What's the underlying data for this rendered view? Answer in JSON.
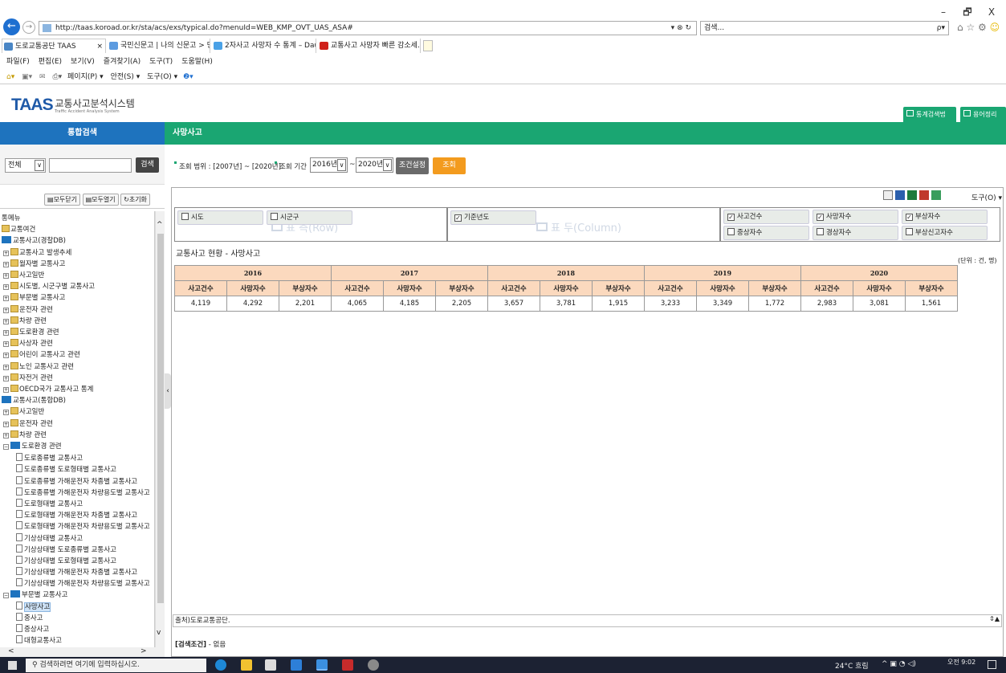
{
  "browser": {
    "url": "http://taas.koroad.or.kr/sta/acs/exs/typical.do?menuId=WEB_KMP_OVT_UAS_ASA#",
    "url_host_bold": "koroad.or.kr",
    "search_placeholder": "검색...",
    "search_icon_label": "ρ▾",
    "tabs": [
      {
        "label": "도로교통공단 TAAS",
        "close": "×"
      },
      {
        "label": "국민신문고 | 나의 신문고 > 민..."
      },
      {
        "label": "2자사고 사망자 수 통계 – Dau..."
      },
      {
        "label": "교통사고 사망자 빠른 감소세..."
      }
    ],
    "menu": [
      "파일(F)",
      "편집(E)",
      "보기(V)",
      "즐겨찾기(A)",
      "도구(T)",
      "도움말(H)"
    ],
    "toolbar": [
      "페이지(P) ▾",
      "안전(S) ▾",
      "도구(O) ▾"
    ],
    "window_controls": [
      "–",
      "🗗",
      "X"
    ]
  },
  "site": {
    "logo": "TAAS",
    "title": "교통사고분석시스템",
    "subtitle": "Traffic Accident Analysis System",
    "top_buttons": [
      "통계검색법",
      "용어정리"
    ]
  },
  "left": {
    "header": "통합검색",
    "select_value": "전체",
    "search_button": "검색",
    "tree_buttons": [
      "모두닫기",
      "모두열기",
      "초기화"
    ],
    "tree": [
      {
        "text": "통메뉴",
        "kind": "plain",
        "indent": 0
      },
      {
        "text": "교통여건",
        "kind": "fold",
        "indent": 0
      },
      {
        "text": "교통사고(경찰DB)",
        "kind": "open",
        "indent": 0
      },
      {
        "text": "교통사고 발생추세",
        "kind": "pfold",
        "indent": 1
      },
      {
        "text": "월자별 교통사고",
        "kind": "pfold",
        "indent": 1
      },
      {
        "text": "사고일반",
        "kind": "pfold",
        "indent": 1
      },
      {
        "text": "시도별, 시군구별 교통사고",
        "kind": "pfold",
        "indent": 1
      },
      {
        "text": "부문별 교통사고",
        "kind": "pfold",
        "indent": 1
      },
      {
        "text": "운전자 관련",
        "kind": "pfold",
        "indent": 1
      },
      {
        "text": "차량 관련",
        "kind": "pfold",
        "indent": 1
      },
      {
        "text": "도로환경 관련",
        "kind": "pfold",
        "indent": 1
      },
      {
        "text": "사상자 관련",
        "kind": "pfold",
        "indent": 1
      },
      {
        "text": "어린이 교통사고 관련",
        "kind": "pfold",
        "indent": 1
      },
      {
        "text": "노인 교통사고 관련",
        "kind": "pfold",
        "indent": 1
      },
      {
        "text": "자전거 관련",
        "kind": "pfold",
        "indent": 1
      },
      {
        "text": "OECD국가 교통사고 통계",
        "kind": "pfold",
        "indent": 1
      },
      {
        "text": "교통사고(통합DB)",
        "kind": "open",
        "indent": 0
      },
      {
        "text": "사고일반",
        "kind": "pfold",
        "indent": 1
      },
      {
        "text": "운전자 관련",
        "kind": "pfold",
        "indent": 1
      },
      {
        "text": "차량 관련",
        "kind": "pfold",
        "indent": 1
      },
      {
        "text": "도로환경 관련",
        "kind": "popen",
        "indent": 1
      },
      {
        "text": "도로종류별 교통사고",
        "kind": "doc",
        "indent": 2
      },
      {
        "text": "도로종류별 도로형태별 교통사고",
        "kind": "doc",
        "indent": 2
      },
      {
        "text": "도로종류별 가해운전자 차종별 교통사고",
        "kind": "doc",
        "indent": 2
      },
      {
        "text": "도로종류별 가해운전자 차량용도별 교통사고",
        "kind": "doc",
        "indent": 2
      },
      {
        "text": "도로형태별 교통사고",
        "kind": "doc",
        "indent": 2
      },
      {
        "text": "도로형태별 가해운전자 차종별 교통사고",
        "kind": "doc",
        "indent": 2
      },
      {
        "text": "도로형태별 가해운전자 차량용도별 교통사고",
        "kind": "doc",
        "indent": 2
      },
      {
        "text": "기상상태별 교통사고",
        "kind": "doc",
        "indent": 2
      },
      {
        "text": "기상상태별 도로종류별 교통사고",
        "kind": "doc",
        "indent": 2
      },
      {
        "text": "기상상태별 도로형태별 교통사고",
        "kind": "doc",
        "indent": 2
      },
      {
        "text": "기상상태별 가해운전자 차종별 교통사고",
        "kind": "doc",
        "indent": 2
      },
      {
        "text": "기상상태별 가해운전자 차량용도별 교통사고",
        "kind": "doc",
        "indent": 2
      },
      {
        "text": "부문별 교통사고",
        "kind": "popen",
        "indent": 1
      },
      {
        "text": "사망사고",
        "kind": "docsel",
        "indent": 2
      },
      {
        "text": "중사고",
        "kind": "doc",
        "indent": 2
      },
      {
        "text": "중상사고",
        "kind": "doc",
        "indent": 2
      },
      {
        "text": "대형교통사고",
        "kind": "doc",
        "indent": 2
      }
    ]
  },
  "main": {
    "header": "사망사고",
    "range_label": "조회 범위 : [2007년] ~ [2020년]",
    "period_label": "조회 기간",
    "from_year": "2016년",
    "tilde": "~",
    "to_year": "2020년",
    "condition_button": "조건설정",
    "query_button": "조회",
    "tools_label": "도구(O) ▾",
    "row_dims": [
      {
        "label": "시도",
        "checked": false
      },
      {
        "label": "시군구",
        "checked": false
      }
    ],
    "row_watermark": "표 측(Row)",
    "col_dims": [
      {
        "label": "기준년도",
        "checked": true
      }
    ],
    "col_watermark": "표 두(Column)",
    "measures": [
      {
        "label": "사고건수",
        "checked": true
      },
      {
        "label": "사망자수",
        "checked": true
      },
      {
        "label": "부상자수",
        "checked": true
      },
      {
        "label": "중상자수",
        "checked": false
      },
      {
        "label": "경상자수",
        "checked": false
      },
      {
        "label": "부상신고자수",
        "checked": false
      }
    ],
    "table_title": "교통사고 현황 - 사망사고",
    "unit": "(단위 : 건, 명)",
    "years": [
      "2016",
      "2017",
      "2018",
      "2019",
      "2020"
    ],
    "col_headers": [
      "사고건수",
      "사망자수",
      "부상자수"
    ],
    "rows": [
      [
        "4,119",
        "4,292",
        "2,201",
        "4,065",
        "4,185",
        "2,205",
        "3,657",
        "3,781",
        "1,915",
        "3,233",
        "3,349",
        "1,772",
        "2,983",
        "3,081",
        "1,561"
      ]
    ],
    "footnote": "출처)도로교통공단.",
    "search_cond_label": "[검색조건]",
    "search_cond_value": "- 없음"
  },
  "taskbar": {
    "search_placeholder": "검색하려면 여기에 입력하십시오.",
    "weather": "24°C 흐림",
    "time": "오전 9:02"
  },
  "colors": {
    "blue": "#1e73be",
    "green": "#1aa672",
    "orange": "#f39b1e",
    "header_peach": "#fbd9be"
  }
}
